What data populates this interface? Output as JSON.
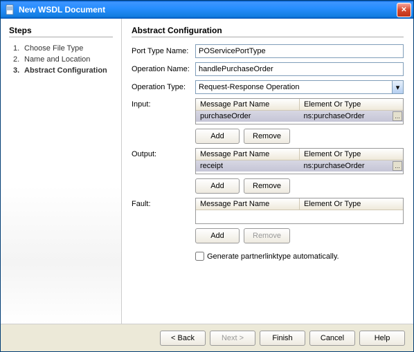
{
  "window": {
    "title": "New WSDL Document"
  },
  "sidebar": {
    "heading": "Steps",
    "items": [
      {
        "num": "1.",
        "label": "Choose File Type"
      },
      {
        "num": "2.",
        "label": "Name and Location"
      },
      {
        "num": "3.",
        "label": "Abstract Configuration"
      }
    ]
  },
  "main": {
    "heading": "Abstract Configuration",
    "portTypeLabel": "Port Type Name:",
    "portTypeValue": "POServicePortType",
    "operationNameLabel": "Operation Name:",
    "operationNameValue": "handlePurchaseOrder",
    "operationTypeLabel": "Operation Type:",
    "operationTypeValue": "Request-Response Operation",
    "colLabels": {
      "part": "Message Part Name",
      "type": "Element Or Type"
    },
    "input": {
      "label": "Input:",
      "row": {
        "part": "purchaseOrder",
        "type": "ns:purchaseOrder"
      }
    },
    "output": {
      "label": "Output:",
      "row": {
        "part": "receipt",
        "type": "ns:purchaseOrder"
      }
    },
    "fault": {
      "label": "Fault:"
    },
    "buttons": {
      "add": "Add",
      "remove": "Remove"
    },
    "checkboxLabel": "Generate partnerlinktype automatically."
  },
  "footer": {
    "back": "< Back",
    "next": "Next >",
    "finish": "Finish",
    "cancel": "Cancel",
    "help": "Help"
  }
}
